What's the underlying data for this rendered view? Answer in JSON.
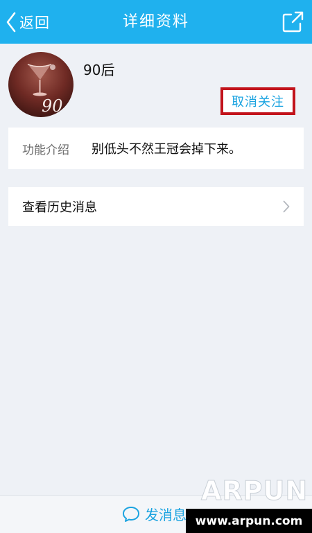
{
  "navbar": {
    "back_label": "返回",
    "title": "详细资料",
    "bg_color": "#1fb1ee"
  },
  "profile": {
    "nickname": "90后",
    "unfollow_label": "取消关注",
    "avatar_text": "90"
  },
  "info": {
    "label": "功能介绍",
    "value": "别低头不然王冠会掉下来。"
  },
  "history": {
    "label": "查看历史消息"
  },
  "bottom": {
    "send_label": "发消息"
  },
  "watermark": {
    "brand": "ARPUN",
    "url": "www.arpun.com"
  },
  "icons": {
    "back": "chevron-left-icon",
    "share": "share-icon",
    "forward": "chevron-right-icon",
    "chat": "chat-bubble-icon"
  },
  "colors": {
    "accent": "#1aa3e0",
    "highlight_box": "#c2131b",
    "page_bg": "#eef1f6"
  }
}
